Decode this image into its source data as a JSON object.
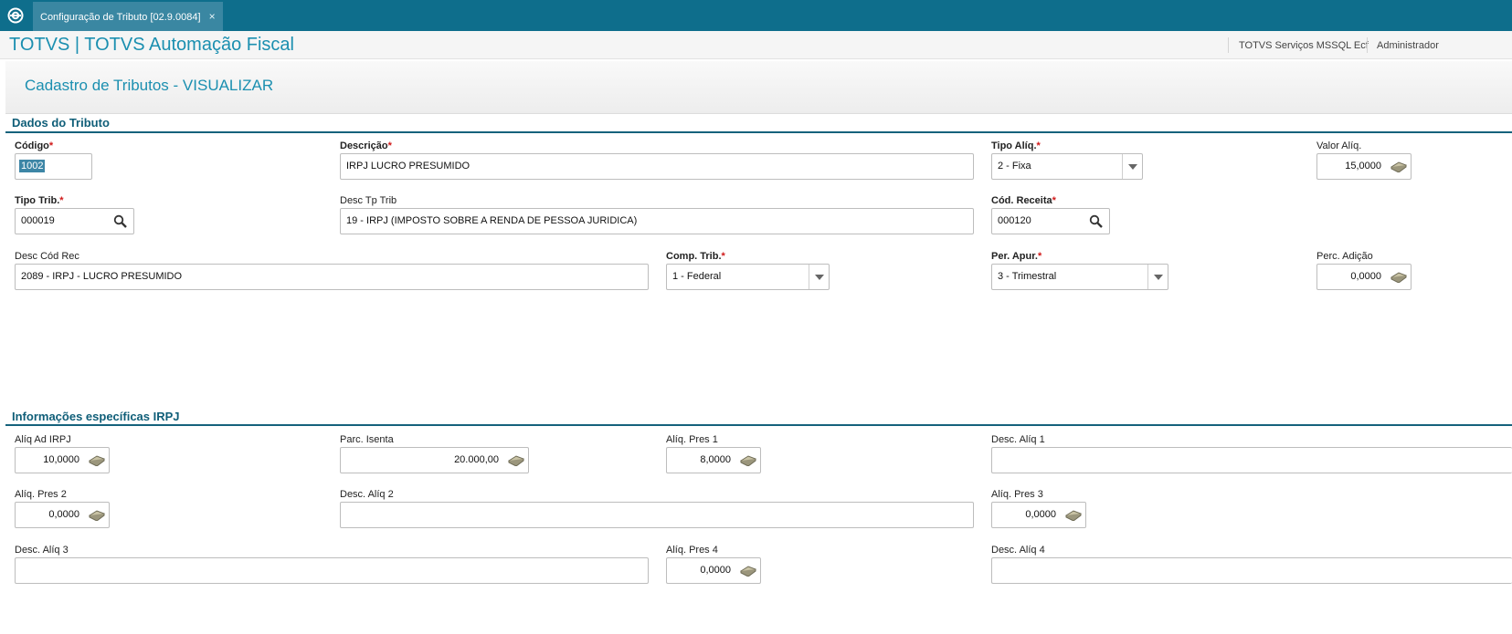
{
  "app": {
    "tab_title": "Configuração de Tributo [02.9.0084]",
    "tab_close": "×",
    "brand": "TOTVS | TOTVS Automação Fiscal",
    "environment": "TOTVS Serviços MSSQL Ecf",
    "user": "Administrador"
  },
  "page": {
    "title": "Cadastro de Tributos - VISUALIZAR"
  },
  "sections": {
    "dados": "Dados do Tributo",
    "irpj": "Informações específicas IRPJ"
  },
  "required_mark": "*",
  "fields": {
    "codigo": {
      "label": "Código",
      "value": "1002"
    },
    "descricao": {
      "label": "Descrição",
      "value": "IRPJ LUCRO PRESUMIDO"
    },
    "tipo_aliq": {
      "label": "Tipo Alíq.",
      "value": "2 - Fixa"
    },
    "valor_aliq": {
      "label": "Valor Alíq.",
      "value": "15,0000"
    },
    "tipo_trib": {
      "label": "Tipo Trib.",
      "value": "000019"
    },
    "desc_tp_trib": {
      "label": "Desc Tp Trib",
      "value": "19 - IRPJ (IMPOSTO SOBRE A RENDA DE PESSOA JURIDICA)"
    },
    "cod_receita": {
      "label": "Cód. Receita",
      "value": "000120"
    },
    "desc_cod_rec": {
      "label": "Desc Cód Rec",
      "value": "2089 - IRPJ - LUCRO PRESUMIDO"
    },
    "comp_trib": {
      "label": "Comp. Trib.",
      "value": "1 - Federal"
    },
    "per_apur": {
      "label": "Per. Apur.",
      "value": "3 - Trimestral"
    },
    "perc_adicao": {
      "label": "Perc. Adição",
      "value": "0,0000"
    },
    "aliq_ad_irpj": {
      "label": "Alíq Ad IRPJ",
      "value": "10,0000"
    },
    "parc_isenta": {
      "label": "Parc. Isenta",
      "value": "20.000,00"
    },
    "aliq_pres_1": {
      "label": "Alíq. Pres 1",
      "value": "8,0000"
    },
    "desc_aliq_1": {
      "label": "Desc. Alíq 1",
      "value": ""
    },
    "aliq_pres_2": {
      "label": "Alíq. Pres 2",
      "value": "0,0000"
    },
    "desc_aliq_2": {
      "label": "Desc. Alíq 2",
      "value": ""
    },
    "aliq_pres_3": {
      "label": "Alíq. Pres 3",
      "value": "0,0000"
    },
    "desc_aliq_3": {
      "label": "Desc. Alíq 3",
      "value": ""
    },
    "aliq_pres_4": {
      "label": "Alíq. Pres 4",
      "value": "0,0000"
    },
    "desc_aliq_4": {
      "label": "Desc. Alíq 4",
      "value": ""
    }
  },
  "icons": {
    "logo": "totvs-logo-icon",
    "lookup": "search-icon",
    "calculator": "calculator-icon",
    "dropdown": "chevron-down-icon"
  },
  "colors": {
    "topbar": "#0e6e8c",
    "accent": "#1b8fb0",
    "section": "#0f5e78",
    "required": "#d01919"
  }
}
